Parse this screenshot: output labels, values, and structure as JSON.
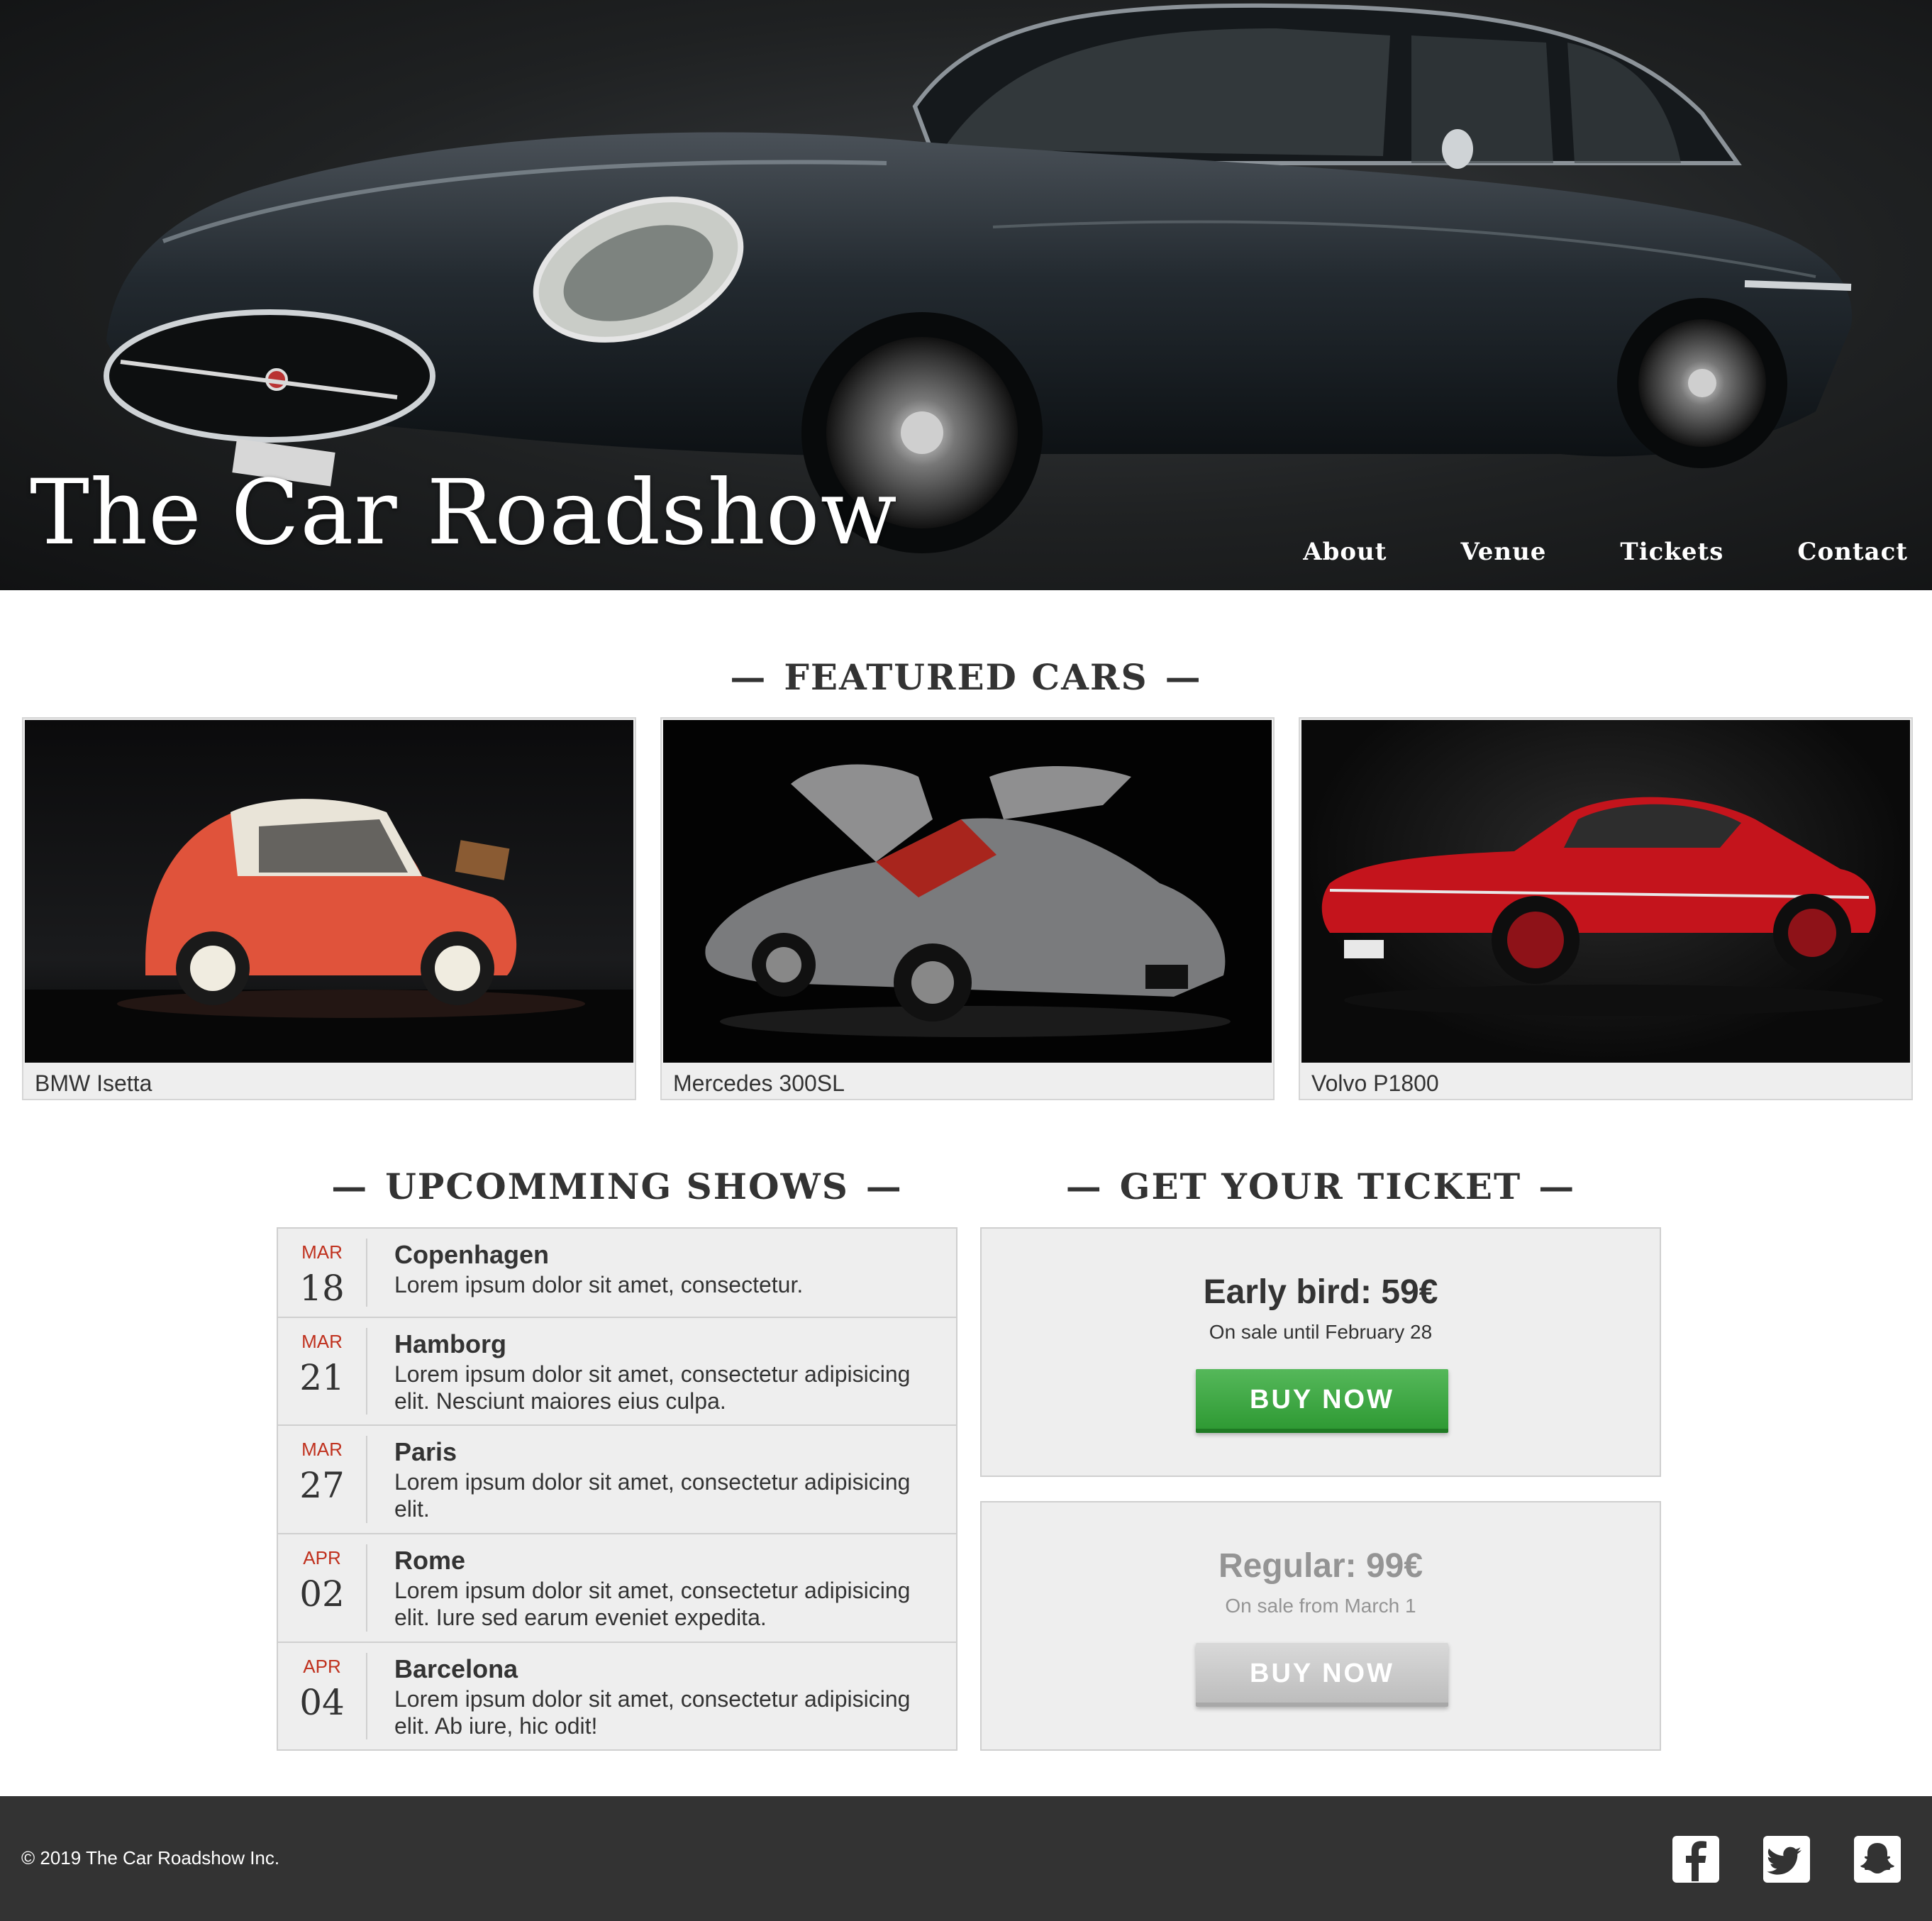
{
  "hero": {
    "title": "The Car Roadshow",
    "image": "black-classic-sports-car",
    "nav": [
      "About",
      "Venue",
      "Tickets",
      "Contact"
    ]
  },
  "featured": {
    "heading": "FEATURED CARS",
    "cars": [
      {
        "name": "BMW Isetta",
        "color": "#e0533b"
      },
      {
        "name": "Mercedes 300SL",
        "color": "#7a7b7d"
      },
      {
        "name": "Volvo P1800",
        "color": "#c4141c"
      }
    ]
  },
  "shows": {
    "heading": "UPCOMMING SHOWS",
    "items": [
      {
        "month": "MAR",
        "day": "18",
        "city": "Copenhagen",
        "desc": "Lorem ipsum dolor sit amet, consectetur."
      },
      {
        "month": "MAR",
        "day": "21",
        "city": "Hamborg",
        "desc": "Lorem ipsum dolor sit amet, consectetur adipisicing elit. Nesciunt maiores eius culpa."
      },
      {
        "month": "MAR",
        "day": "27",
        "city": "Paris",
        "desc": "Lorem ipsum dolor sit amet, consectetur adipisicing elit."
      },
      {
        "month": "APR",
        "day": "02",
        "city": "Rome",
        "desc": "Lorem ipsum dolor sit amet, consectetur adipisicing elit. Iure sed earum eveniet expedita."
      },
      {
        "month": "APR",
        "day": "04",
        "city": "Barcelona",
        "desc": "Lorem ipsum dolor sit amet, consectetur adipisicing elit. Ab iure, hic odit!"
      }
    ]
  },
  "tickets": {
    "heading": "GET YOUR TICKET",
    "items": [
      {
        "title": "Early bird: 59€",
        "sub": "On sale until February 28",
        "button": "BUY NOW",
        "state": "active"
      },
      {
        "title": "Regular: 99€",
        "sub": "On sale from March 1",
        "button": "BUY NOW",
        "state": "inactive"
      }
    ]
  },
  "footer": {
    "copyright": "© 2019 The Car Roadshow Inc.",
    "social": [
      "facebook-icon",
      "twitter-icon",
      "snapchat-icon"
    ]
  },
  "colors": {
    "accent_red": "#c0311e",
    "buy_green": "#3aa63f",
    "footer_bg": "#333333",
    "panel_bg": "#eeeeee"
  }
}
